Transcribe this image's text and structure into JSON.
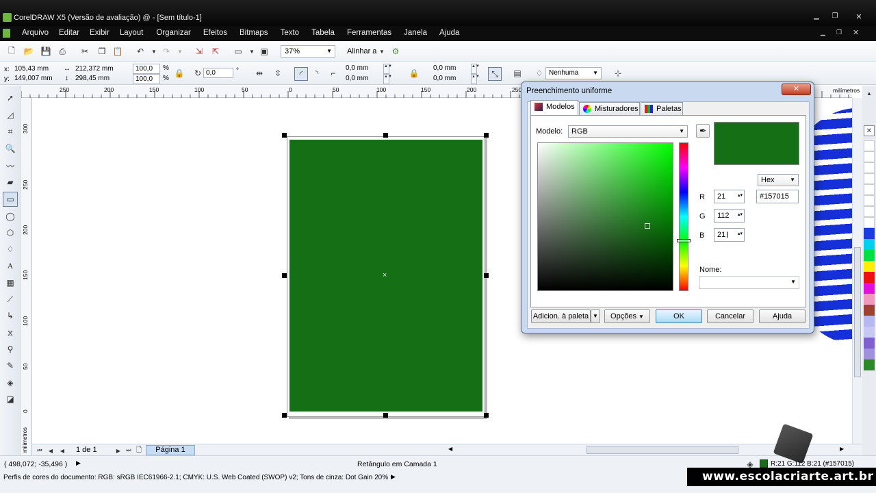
{
  "window": {
    "title": "CorelDRAW X5 (Versão de avaliação) @ - [Sem título-1]"
  },
  "menu": [
    "Arquivo",
    "Editar",
    "Exibir",
    "Layout",
    "Organizar",
    "Efeitos",
    "Bitmaps",
    "Texto",
    "Tabela",
    "Ferramentas",
    "Janela",
    "Ajuda"
  ],
  "toolbar": {
    "zoom": "37%",
    "align": "Alinhar a"
  },
  "props": {
    "x": "x:",
    "x_val": "105,43 mm",
    "y": "y:",
    "y_val": "149,007 mm",
    "w_val": "212,372 mm",
    "h_val": "298,45 mm",
    "sx": "100,0",
    "sy": "100,0",
    "pct": "%",
    "angle": "0,0",
    "deg": "°",
    "c1": "0,0 mm",
    "c2": "0,0 mm",
    "c3": "0,0 mm",
    "c4": "0,0 mm",
    "outline": "Nenhuma"
  },
  "ruler": {
    "h_ticks": [
      "250",
      "200",
      "150",
      "100",
      "50",
      "0",
      "50",
      "100",
      "150",
      "200",
      "250"
    ],
    "v_ticks": [
      "300",
      "250",
      "200",
      "150",
      "100",
      "50",
      "0"
    ],
    "unit": "milímetros",
    "v_unit": "milímetros"
  },
  "pages": {
    "count": "1 de 1",
    "tab": "Página 1"
  },
  "status": {
    "coords": "( 498,072; -35,496 )",
    "object": "Retângulo em Camada 1",
    "profile": "Perfis de cores do documento: RGB: sRGB IEC61966-2.1; CMYK: U.S. Web Coated (SWOP) v2; Tons de cinza: Dot Gain 20%",
    "color_info": "R:21 G:112 B:21 (#157015)"
  },
  "watermark": "www.escolacriarte.art.br",
  "dialog": {
    "title": "Preenchimento uniforme",
    "tabs": [
      "Modelos",
      "Misturadores",
      "Paletas"
    ],
    "model_label": "Modelo:",
    "model_value": "RGB",
    "hex_mode": "Hex",
    "r_label": "R",
    "r": "21",
    "g_label": "G",
    "g": "112",
    "b_label": "B",
    "b": "21",
    "hex": "#157015",
    "name_label": "Nome:",
    "buttons": {
      "add": "Adicion. à paleta",
      "options": "Opções",
      "ok": "OK",
      "cancel": "Cancelar",
      "help": "Ajuda"
    }
  },
  "colors": {
    "fill": "#157015",
    "accent": "#4a86c8"
  }
}
